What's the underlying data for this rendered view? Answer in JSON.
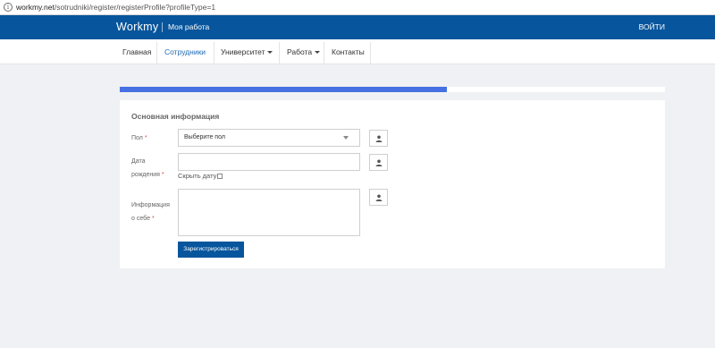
{
  "browser": {
    "url_host": "workmy.net",
    "url_path": "/sotrudniki/register/registerProfile?profileType=1"
  },
  "header": {
    "brand": "Workmy",
    "my_work": "Моя работа",
    "login": "ВОЙТИ",
    "background_color": "#07559c"
  },
  "nav": {
    "items": [
      {
        "label": "Главная",
        "active": false,
        "dropdown": false
      },
      {
        "label": "Сотрудники",
        "active": true,
        "dropdown": false
      },
      {
        "label": "Университет",
        "active": false,
        "dropdown": true
      },
      {
        "label": "Работа",
        "active": false,
        "dropdown": true
      },
      {
        "label": "Контакты",
        "active": false,
        "dropdown": false
      }
    ]
  },
  "progress": {
    "fraction": 0.6,
    "color": "#4571e2"
  },
  "form": {
    "section_title": "Основная информация",
    "gender": {
      "label": "Пол",
      "required_mark": "*",
      "selected": "Выберите пол"
    },
    "birth_date": {
      "label_line1": "Дата",
      "label_line2": "рождения",
      "required_mark": "*",
      "value": "",
      "hide_label": "Скрыть дату",
      "hide_checked": false
    },
    "about": {
      "label_line1": "Информация",
      "label_line2": "о себе",
      "required_mark": "*",
      "value": ""
    },
    "privacy_icon": "user-icon",
    "submit_label": "Зарегистрироваться"
  }
}
